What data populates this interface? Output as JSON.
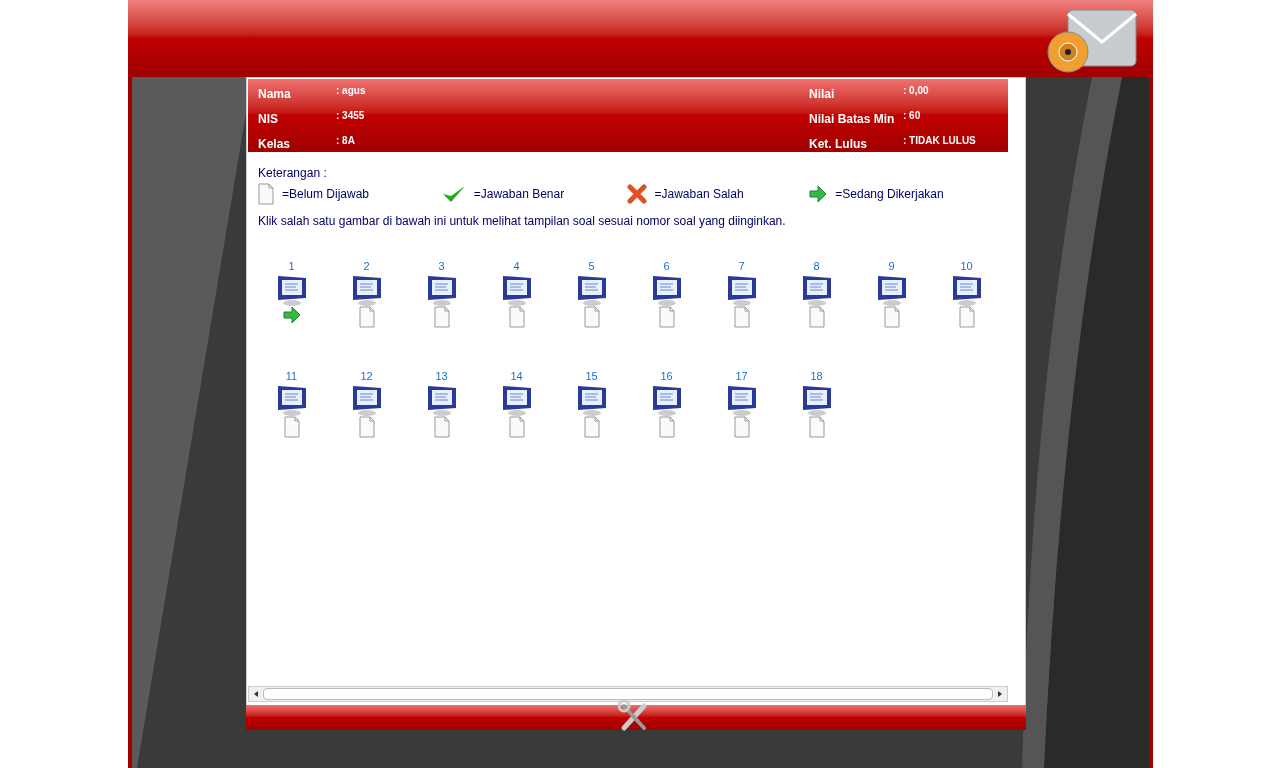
{
  "student_info": {
    "left": [
      {
        "label": "Nama",
        "value": ": agus"
      },
      {
        "label": "NIS",
        "value": ": 3455"
      },
      {
        "label": "Kelas",
        "value": ": 8A"
      }
    ],
    "right": [
      {
        "label": "Nilai",
        "value": ": 0,00"
      },
      {
        "label": "Nilai Batas Min",
        "value": ": 60"
      },
      {
        "label": "Ket. Lulus",
        "value": ": TIDAK LULUS"
      }
    ]
  },
  "legend": {
    "title": "Keterangan :",
    "items": [
      {
        "kind": "unanswered",
        "label": "=Belum Dijawab"
      },
      {
        "kind": "correct",
        "label": "=Jawaban Benar"
      },
      {
        "kind": "wrong",
        "label": "=Jawaban Salah"
      },
      {
        "kind": "current",
        "label": "=Sedang Dikerjakan"
      }
    ]
  },
  "instruction": "Klik salah satu gambar di bawah ini untuk melihat tampilan soal sesuai nomor soal yang diinginkan.",
  "questions": [
    {
      "number": "1",
      "kind": "current"
    },
    {
      "number": "2",
      "kind": "unanswered"
    },
    {
      "number": "3",
      "kind": "unanswered"
    },
    {
      "number": "4",
      "kind": "unanswered"
    },
    {
      "number": "5",
      "kind": "unanswered"
    },
    {
      "number": "6",
      "kind": "unanswered"
    },
    {
      "number": "7",
      "kind": "unanswered"
    },
    {
      "number": "8",
      "kind": "unanswered"
    },
    {
      "number": "9",
      "kind": "unanswered"
    },
    {
      "number": "10",
      "kind": "unanswered"
    },
    {
      "number": "11",
      "kind": "unanswered"
    },
    {
      "number": "12",
      "kind": "unanswered"
    },
    {
      "number": "13",
      "kind": "unanswered"
    },
    {
      "number": "14",
      "kind": "unanswered"
    },
    {
      "number": "15",
      "kind": "unanswered"
    },
    {
      "number": "16",
      "kind": "unanswered"
    },
    {
      "number": "17",
      "kind": "unanswered"
    },
    {
      "number": "18",
      "kind": "unanswered"
    }
  ]
}
